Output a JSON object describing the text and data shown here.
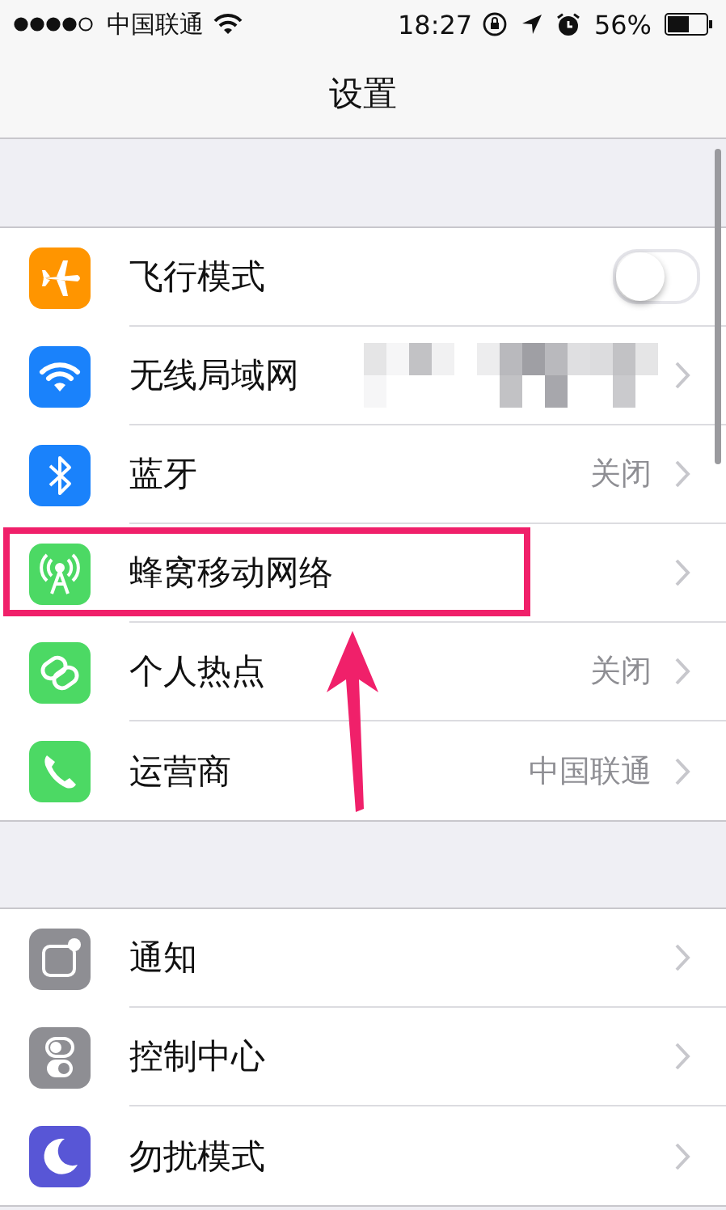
{
  "status_bar": {
    "carrier": "中国联通",
    "time": "18:27",
    "battery": "56%"
  },
  "nav": {
    "title": "设置"
  },
  "groups": [
    {
      "rows": [
        {
          "kind": "toggle",
          "label": "飞行模式",
          "color": "#ff9500",
          "on": false,
          "highlighted": false
        },
        {
          "kind": "link",
          "label": "无线局域网",
          "color": "#1a82fb",
          "redacted": true,
          "highlighted": false
        },
        {
          "kind": "link",
          "label": "蓝牙",
          "color": "#1a82fb",
          "value": "关闭",
          "highlighted": false
        },
        {
          "kind": "link",
          "label": "蜂窝移动网络",
          "color": "#4cd964",
          "highlighted": true
        },
        {
          "kind": "link",
          "label": "个人热点",
          "color": "#4cd964",
          "value": "关闭",
          "highlighted": false
        },
        {
          "kind": "link",
          "label": "运营商",
          "color": "#4cd964",
          "value": "中国联通",
          "highlighted": false
        }
      ]
    },
    {
      "rows": [
        {
          "kind": "link",
          "label": "通知",
          "color": "#8e8e93",
          "highlighted": false
        },
        {
          "kind": "link",
          "label": "控制中心",
          "color": "#8e8e93",
          "highlighted": false
        },
        {
          "kind": "link",
          "label": "勿扰模式",
          "color": "#5856d6",
          "highlighted": false
        }
      ]
    }
  ]
}
